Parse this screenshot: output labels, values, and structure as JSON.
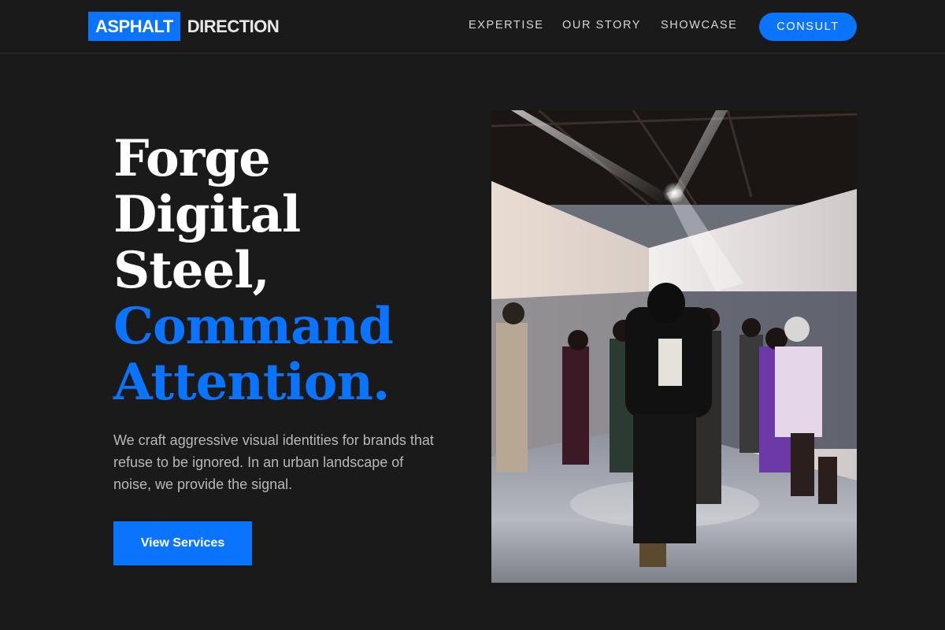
{
  "brand": {
    "mark": "ASPHALT",
    "word": "DIRECTION"
  },
  "nav": {
    "items": [
      "EXPERTISE",
      "OUR STORY",
      "SHOWCASE"
    ],
    "cta_label": "CONSULT"
  },
  "hero": {
    "headline_white": [
      "Forge",
      "Digital",
      "Steel,"
    ],
    "headline_blue": [
      "Command",
      "Attention."
    ],
    "lead": "We craft aggressive visual identities for brands that refuse to be ignored. In an urban landscape of noise, we provide the signal.",
    "button_label": "View Services"
  },
  "colors": {
    "accent": "#0a74ff",
    "background": "#1a1a1b",
    "text": "#ffffff",
    "muted": "#b8b8b8"
  }
}
